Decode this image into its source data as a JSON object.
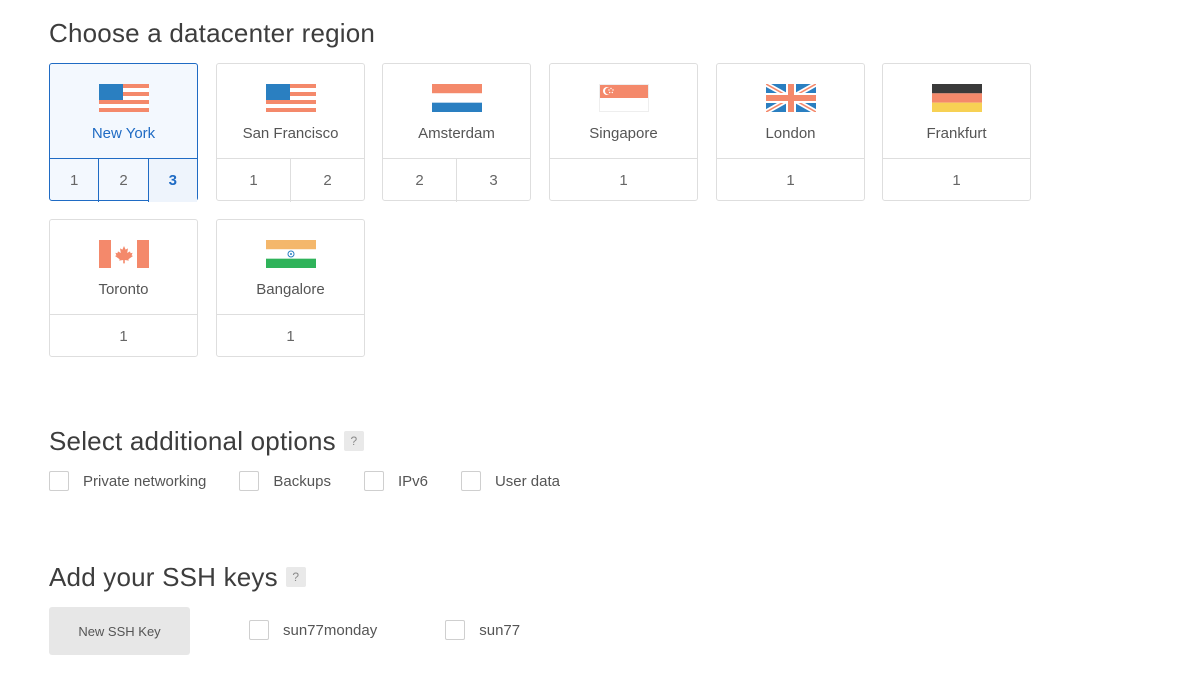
{
  "region_section": {
    "title": "Choose a datacenter region",
    "regions": [
      {
        "name": "New York",
        "flag": "us-flag",
        "datacenters": [
          "1",
          "2",
          "3"
        ],
        "selected": true,
        "active_datacenter": "3"
      },
      {
        "name": "San Francisco",
        "flag": "us-flag",
        "datacenters": [
          "1",
          "2"
        ]
      },
      {
        "name": "Amsterdam",
        "flag": "netherlands-flag",
        "datacenters": [
          "2",
          "3"
        ]
      },
      {
        "name": "Singapore",
        "flag": "singapore-flag",
        "datacenters": [
          "1"
        ]
      },
      {
        "name": "London",
        "flag": "uk-flag",
        "datacenters": [
          "1"
        ]
      },
      {
        "name": "Frankfurt",
        "flag": "germany-flag",
        "datacenters": [
          "1"
        ]
      },
      {
        "name": "Toronto",
        "flag": "canada-flag",
        "datacenters": [
          "1"
        ]
      },
      {
        "name": "Bangalore",
        "flag": "india-flag",
        "datacenters": [
          "1"
        ]
      }
    ]
  },
  "options_section": {
    "title": "Select additional options",
    "help": "?",
    "options": [
      "Private networking",
      "Backups",
      "IPv6",
      "User data"
    ]
  },
  "ssh_section": {
    "title": "Add your SSH keys",
    "help": "?",
    "new_key_label": "New SSH Key",
    "keys": [
      "sun77monday",
      "sun77"
    ]
  },
  "colors": {
    "accent": "#1f6bc4",
    "flag_blue": "#2a7fc1",
    "flag_orange": "#f4896b",
    "border": "#dedede"
  }
}
